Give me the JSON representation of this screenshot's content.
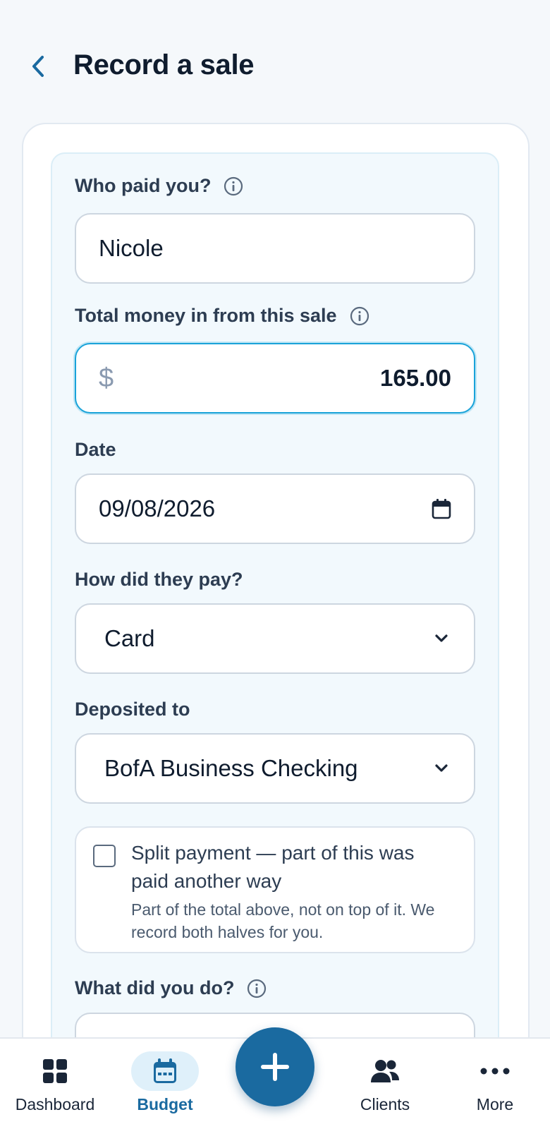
{
  "header": {
    "title": "Record a sale"
  },
  "form": {
    "payer": {
      "label": "Who paid you?",
      "value": "Nicole"
    },
    "amount": {
      "label": "Total money in from this sale",
      "currency": "$",
      "value": "165.00"
    },
    "date": {
      "label": "Date",
      "value": "09/08/2026"
    },
    "method": {
      "label": "How did they pay?",
      "value": "Card"
    },
    "deposit": {
      "label": "Deposited to",
      "value": "BofA Business Checking"
    },
    "split": {
      "title": "Split payment — part of this was paid another way",
      "help": "Part of the total above, not on top of it. We record both halves for you.",
      "checked": false
    },
    "service": {
      "label": "What did you do?"
    }
  },
  "nav": {
    "items": [
      {
        "label": "Dashboard",
        "icon": "grid-icon"
      },
      {
        "label": "Budget",
        "icon": "calendar-icon",
        "active": true
      },
      {
        "label": "Clients",
        "icon": "people-icon"
      },
      {
        "label": "More",
        "icon": "more-icon"
      }
    ],
    "fab_icon": "plus-icon"
  },
  "colors": {
    "accent": "#1a6aa0",
    "focus": "#1aa3d9",
    "background": "#f5f8fb"
  }
}
